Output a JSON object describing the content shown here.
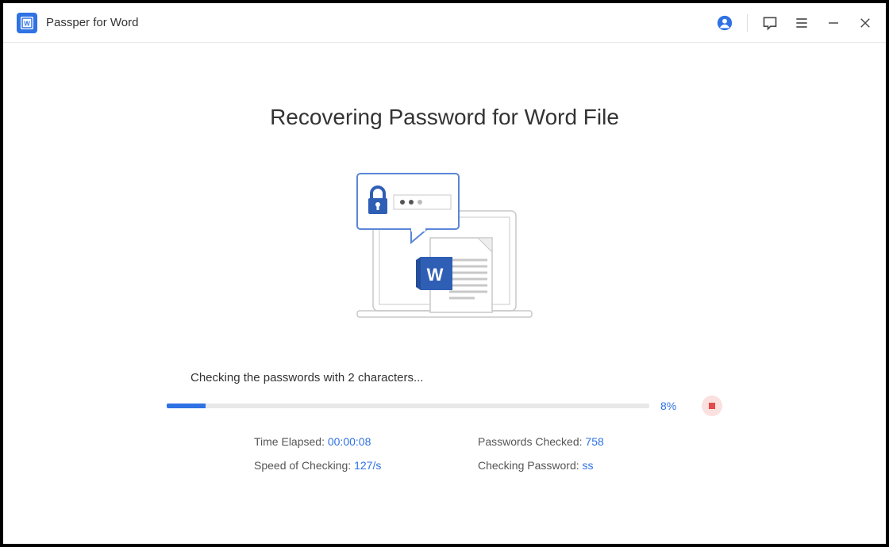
{
  "app": {
    "title": "Passper for Word"
  },
  "main": {
    "title": "Recovering Password for Word File",
    "status_text": "Checking the passwords with 2 characters..."
  },
  "progress": {
    "percent_label": "8%",
    "percent_value": 8
  },
  "stats": {
    "time_elapsed": {
      "label": "Time Elapsed: ",
      "value": "00:00:08"
    },
    "passwords_checked": {
      "label": "Passwords Checked: ",
      "value": "758"
    },
    "speed": {
      "label": "Speed of Checking: ",
      "value": "127/s"
    },
    "checking_password": {
      "label": "Checking Password: ",
      "value": "ss"
    }
  }
}
